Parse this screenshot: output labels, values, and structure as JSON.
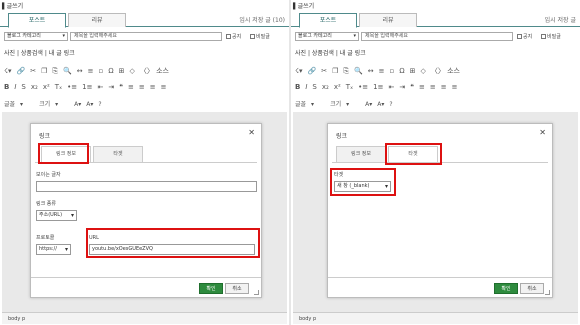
{
  "panels": [
    {
      "window_title": "▌글쓰기",
      "tab_post": "포스트",
      "tab_review": "리뷰",
      "draft": "임시 저장 글 (10)",
      "category": "블로그 카테고리",
      "title_placeholder": "제목을 입력해주세요",
      "notice": "공지",
      "secret": "비밀글",
      "insert_bar": "사진 | 상품검색 | 내 글 링크",
      "status": "body  p"
    },
    {
      "window_title": "▌글쓰기",
      "tab_post": "포스트",
      "tab_review": "리뷰",
      "draft": "임시 저장 글",
      "category": "블로그 카테고리",
      "title_placeholder": "제목을 입력해주세요",
      "notice": "공지",
      "secret": "비밀글",
      "insert_bar": "사진 | 상품검색 | 내 글 링크",
      "status": "body  p"
    }
  ],
  "toolbar": {
    "row1": [
      "☇▾",
      "🔗",
      "✂",
      "❐",
      "⎘",
      "🔍",
      "↔",
      "≡",
      "▫",
      "Ω",
      "⊞",
      "◇",
      "✂",
      "〈〉 소스"
    ],
    "row2": [
      "B",
      "I",
      "S",
      "x₂",
      "x²",
      "Tₓ",
      "•≡",
      "1≡",
      "⇤",
      "⇥",
      "❝",
      "≡",
      "≡",
      "≡",
      "≡"
    ],
    "row3": [
      "글꼴",
      "▾",
      "크기",
      "▾",
      "A▾",
      "A▾",
      "?"
    ]
  },
  "link_dialog": {
    "title": "링크",
    "close": "✕",
    "tab_link_info": "링크 정보",
    "tab_target": "타겟",
    "display_text_label": "보이는 글자",
    "link_type_label": "링크 종류",
    "link_type_value": "주소(URL)",
    "protocol_label": "프로토콜",
    "protocol_value": "https://",
    "url_label": "URL",
    "url_value": "youtu.be/xOesGUEeZVQ",
    "ok": "확인",
    "cancel": "취소"
  },
  "target_dialog": {
    "title": "링크",
    "close": "✕",
    "tab_link_info": "링크 정보",
    "tab_target": "타겟",
    "target_label": "타겟",
    "target_value": "새 창 (_blank)",
    "ok": "확인",
    "cancel": "취소"
  },
  "colors": {
    "accent": "#4f8a8b",
    "highlight": "#d11111",
    "ok_button": "#2e8b3e"
  }
}
